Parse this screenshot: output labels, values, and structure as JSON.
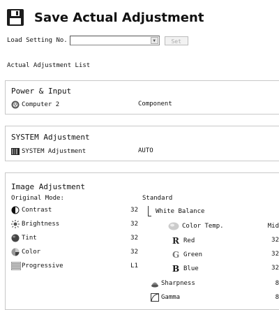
{
  "header": {
    "title": "Save Actual Adjustment"
  },
  "load": {
    "label": "Load Setting No.",
    "select_value": "",
    "set_label": "Set"
  },
  "list_title": "Actual Adjustment List",
  "power_input": {
    "heading": "Power & Input",
    "source": "Computer 2",
    "type": "Component"
  },
  "system": {
    "heading": "SYSTEM Adjustment",
    "label": "SYSTEM Adjustment",
    "value": "AUTO"
  },
  "image": {
    "heading": "Image Adjustment",
    "mode_label": "Original Mode:",
    "mode_value": "Standard",
    "left": [
      {
        "label": "Contrast",
        "value": "32",
        "icon": "contrast-icon"
      },
      {
        "label": "Brightness",
        "value": "32",
        "icon": "brightness-icon"
      },
      {
        "label": "Tint",
        "value": "32",
        "icon": "tint-icon"
      },
      {
        "label": "Color",
        "value": "32",
        "icon": "color-icon"
      },
      {
        "label": "Progressive",
        "value": "L1",
        "icon": "progressive-icon"
      }
    ],
    "white_balance": "White Balance",
    "right": [
      {
        "label": "Color Temp.",
        "value": "Mid",
        "icon": "color-temp-icon"
      },
      {
        "label": "Red",
        "value": "32",
        "glyph": "R"
      },
      {
        "label": "Green",
        "value": "32",
        "glyph": "G"
      },
      {
        "label": "Blue",
        "value": "32",
        "glyph": "B"
      },
      {
        "label": "Sharpness",
        "value": "8",
        "icon": "sharpness-icon"
      },
      {
        "label": "Gamma",
        "value": "8",
        "icon": "gamma-icon"
      }
    ]
  }
}
